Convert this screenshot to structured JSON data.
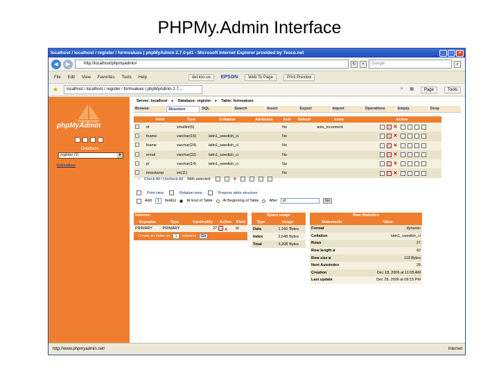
{
  "slide": {
    "title": "PHPMy.Admin Interface"
  },
  "window": {
    "title": "localhost / localhost / register / formvalues | phpMyAdmin 2.7.0-pl1 - Microsoft Internet Explorer provided by Tesco.net"
  },
  "browser": {
    "address": "http://localhost/phpmyadmin/",
    "search_placeholder": "Google",
    "menu": [
      "File",
      "Edit",
      "View",
      "Favorites",
      "Tools",
      "Help"
    ],
    "toolbar": {
      "del_icious": "del.icio.us",
      "epson": "EPSON",
      "web_to_page": "Web To Page",
      "print_preview": "Print Preview"
    },
    "tab_label": "localhost / localhost / register / formvalues | phpMyAdmin 2.7...",
    "tab_tools": {
      "page": "Page",
      "tools": "Tools"
    },
    "status_url": "http://www.phpmyadmin.net/",
    "status_zone": "Internet"
  },
  "left": {
    "logo": "phpMyAdmin",
    "db_label": "Database",
    "db_selected": "register (1)",
    "table_link": "formvalues"
  },
  "crumbs": {
    "server": "Server: localhost",
    "database": "Database: register",
    "table": "Table: formvalues"
  },
  "tabs": [
    "Browse",
    "Structure",
    "SQL",
    "Search",
    "Insert",
    "Export",
    "Import",
    "Operations",
    "Empty",
    "Drop"
  ],
  "fields": {
    "headers": [
      "",
      "Field",
      "Type",
      "Collation",
      "Attributes",
      "Null",
      "Default",
      "Extra",
      "Action"
    ],
    "rows": [
      {
        "field": "id",
        "type": "smallint(5)",
        "collation": "",
        "attributes": "",
        "null": "No",
        "default": "",
        "extra": "auto_increment"
      },
      {
        "field": "fname",
        "type": "varchar(15)",
        "collation": "latin1_swedish_ci",
        "attributes": "",
        "null": "No",
        "default": "",
        "extra": ""
      },
      {
        "field": "lname",
        "type": "varchar(24)",
        "collation": "latin1_swedish_ci",
        "attributes": "",
        "null": "No",
        "default": "",
        "extra": ""
      },
      {
        "field": "email",
        "type": "varchar(32)",
        "collation": "latin1_swedish_ci",
        "attributes": "",
        "null": "No",
        "default": "",
        "extra": ""
      },
      {
        "field": "pl",
        "type": "varchar(14)",
        "collation": "latin1_swedish_ci",
        "attributes": "",
        "null": "No",
        "default": "",
        "extra": ""
      },
      {
        "field": "timestamp",
        "type": "int(11)",
        "collation": "",
        "attributes": "",
        "null": "No",
        "default": "",
        "extra": ""
      }
    ]
  },
  "below": {
    "check_all": "Check All / Uncheck All",
    "with_selected": "With selected:",
    "print_view": "Print view",
    "relation_view": "Relation view",
    "propose": "Propose table structure",
    "add": "Add",
    "add_count": "1",
    "fields_label": "field(s)",
    "at_end": "At End of Table",
    "at_begin": "At Beginning of Table",
    "after": "After",
    "after_field": "id",
    "go": "Go"
  },
  "indexes": {
    "title": "Indexes:",
    "headers": [
      "Keyname",
      "Type",
      "Cardinality",
      "Action",
      "Field"
    ],
    "row": {
      "keyname": "PRIMARY",
      "type": "PRIMARY",
      "cardinality": "27",
      "field": "id"
    },
    "create_label": "Create an index on",
    "create_count": "1",
    "create_suffix": "columns",
    "go": "Go"
  },
  "space_usage": {
    "title": "Space usage",
    "headers": [
      "Type",
      "Usage"
    ],
    "rows": [
      {
        "type": "Data",
        "value": "1,160",
        "unit": "Bytes"
      },
      {
        "type": "Index",
        "value": "2,048",
        "unit": "Bytes"
      },
      {
        "type": "Total",
        "value": "3,208",
        "unit": "Bytes"
      }
    ]
  },
  "row_stats": {
    "title": "Row Statistics",
    "headers": [
      "Statements",
      "Value"
    ],
    "rows": [
      {
        "label": "Format",
        "value": "dynamic"
      },
      {
        "label": "Collation",
        "value": "latin1_swedish_ci"
      },
      {
        "label": "Rows",
        "value": "27"
      },
      {
        "label": "Row length ø",
        "value": "42"
      },
      {
        "label": "Row size ø",
        "value": "119 Bytes"
      },
      {
        "label": "Next Autoindex",
        "value": "28"
      },
      {
        "label": "Creation",
        "value": "Dec 18, 2006 at 11:05 AM"
      },
      {
        "label": "Last update",
        "value": "Dec 28, 2006 at 09:15 PM"
      }
    ]
  }
}
